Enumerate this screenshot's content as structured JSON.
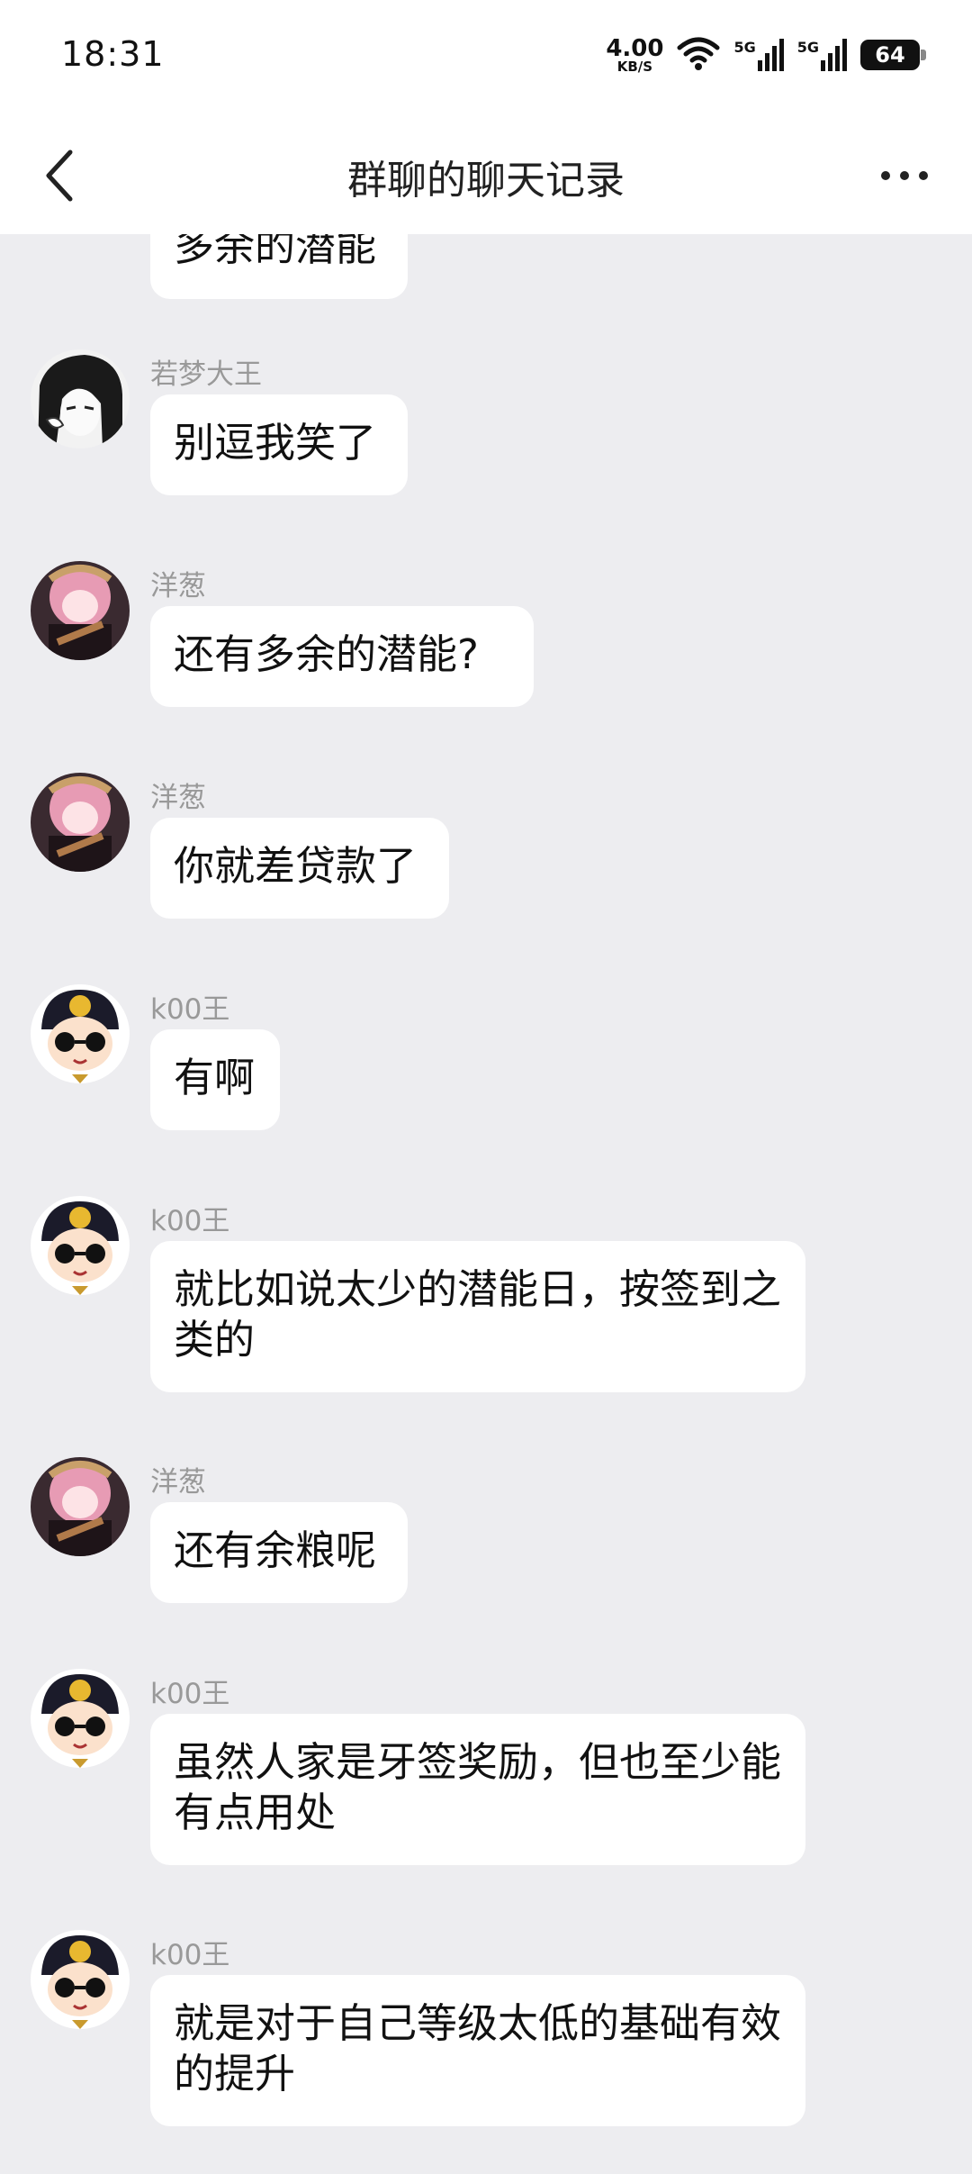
{
  "status_bar": {
    "time": "18:31",
    "net_speed_value": "4.00",
    "net_speed_unit": "KB/S",
    "signal1_label": "5G",
    "signal2_label": "5G",
    "battery_level": "64"
  },
  "header": {
    "title": "群聊的聊天记录",
    "back_icon": "chevron-left-icon",
    "more_icon": "more-horizontal-icon"
  },
  "messages": [
    {
      "sender": "",
      "avatar": "anime-girl-avatar",
      "text": "多余的潜能"
    },
    {
      "sender": "若梦大王",
      "avatar": "anime-girl-avatar",
      "text": "别逗我笑了"
    },
    {
      "sender": "洋葱",
      "avatar": "pink-hair-guitar-avatar",
      "text": "还有多余的潜能?"
    },
    {
      "sender": "洋葱",
      "avatar": "pink-hair-guitar-avatar",
      "text": "你就差贷款了"
    },
    {
      "sender": "k00王",
      "avatar": "cartoon-sunglasses-avatar",
      "text": "有啊"
    },
    {
      "sender": "k00王",
      "avatar": "cartoon-sunglasses-avatar",
      "text": "就比如说太少的潜能日，按签到之类的"
    },
    {
      "sender": "洋葱",
      "avatar": "pink-hair-guitar-avatar",
      "text": "还有余粮呢"
    },
    {
      "sender": "k00王",
      "avatar": "cartoon-sunglasses-avatar",
      "text": "虽然人家是牙签奖励，但也至少能有点用处"
    },
    {
      "sender": "k00王",
      "avatar": "cartoon-sunglasses-avatar",
      "text": "就是对于自己等级太低的基础有效的提升"
    }
  ],
  "colors": {
    "background": "#ededf0",
    "bubble": "#ffffff",
    "sender_text": "#999999",
    "message_text": "#111111"
  }
}
